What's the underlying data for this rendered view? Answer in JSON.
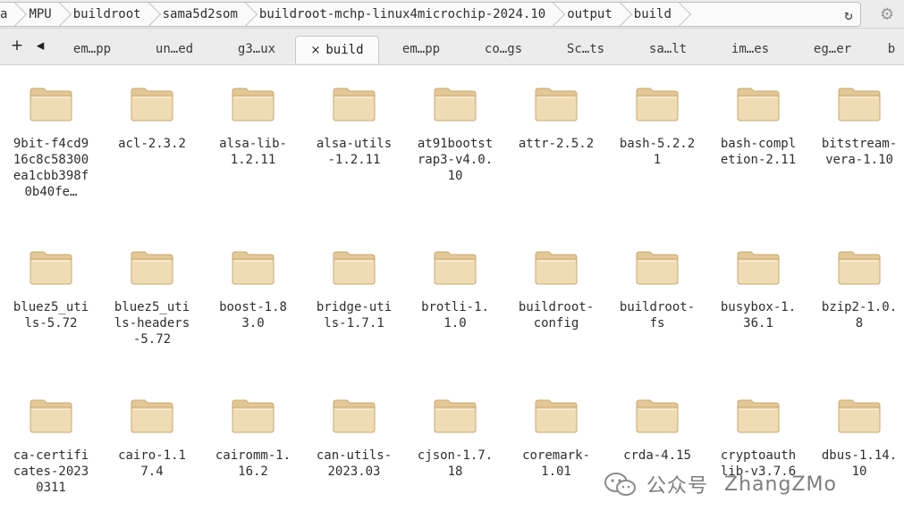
{
  "pathbar": {
    "crumbs": [
      "a",
      "MPU",
      "buildroot",
      "sama5d2som",
      "buildroot-mchp-linux4microchip-2024.10",
      "output",
      "build"
    ],
    "reload_icon": "reload-icon",
    "settings_icon": "gear-icon"
  },
  "tabs": [
    {
      "label": "em…pp",
      "active": false
    },
    {
      "label": "un…ed",
      "active": false
    },
    {
      "label": "g3…ux",
      "active": false
    },
    {
      "label": "build",
      "active": true
    },
    {
      "label": "em…pp",
      "active": false
    },
    {
      "label": "co…gs",
      "active": false
    },
    {
      "label": "Sc…ts",
      "active": false
    },
    {
      "label": "sa…lt",
      "active": false
    },
    {
      "label": "im…es",
      "active": false
    },
    {
      "label": "eg…er",
      "active": false
    },
    {
      "label": "b",
      "active": false
    }
  ],
  "tabbar": {
    "new_tab": "+",
    "scroll_left": "◂",
    "close_glyph": "×"
  },
  "files": [
    "9bit-f4cd916c8c58300ea1cbb398f0b40fe…",
    "acl-2.3.2",
    "alsa-lib-1.2.11",
    "alsa-utils-1.2.11",
    "at91bootstrap3-v4.0.10",
    "attr-2.5.2",
    "bash-5.2.21",
    "bash-completion-2.11",
    "bitstream-vera-1.10",
    "bluez5_utils-5.72",
    "bluez5_utils-headers-5.72",
    "boost-1.83.0",
    "bridge-utils-1.7.1",
    "brotli-1.1.0",
    "buildroot-config",
    "buildroot-fs",
    "busybox-1.36.1",
    "bzip2-1.0.8",
    "ca-certificates-20230311",
    "cairo-1.17.4",
    "cairomm-1.16.2",
    "can-utils-2023.03",
    "cjson-1.7.18",
    "coremark-1.01",
    "crda-4.15",
    "cryptoauthlib-v3.7.6",
    "dbus-1.14.10"
  ],
  "watermark": {
    "cn": "公众号",
    "name": "ZhangZMo"
  },
  "colors": {
    "folder_body": "#f0dcb4",
    "folder_tab": "#e3c896",
    "folder_edge": "#c9a971"
  }
}
